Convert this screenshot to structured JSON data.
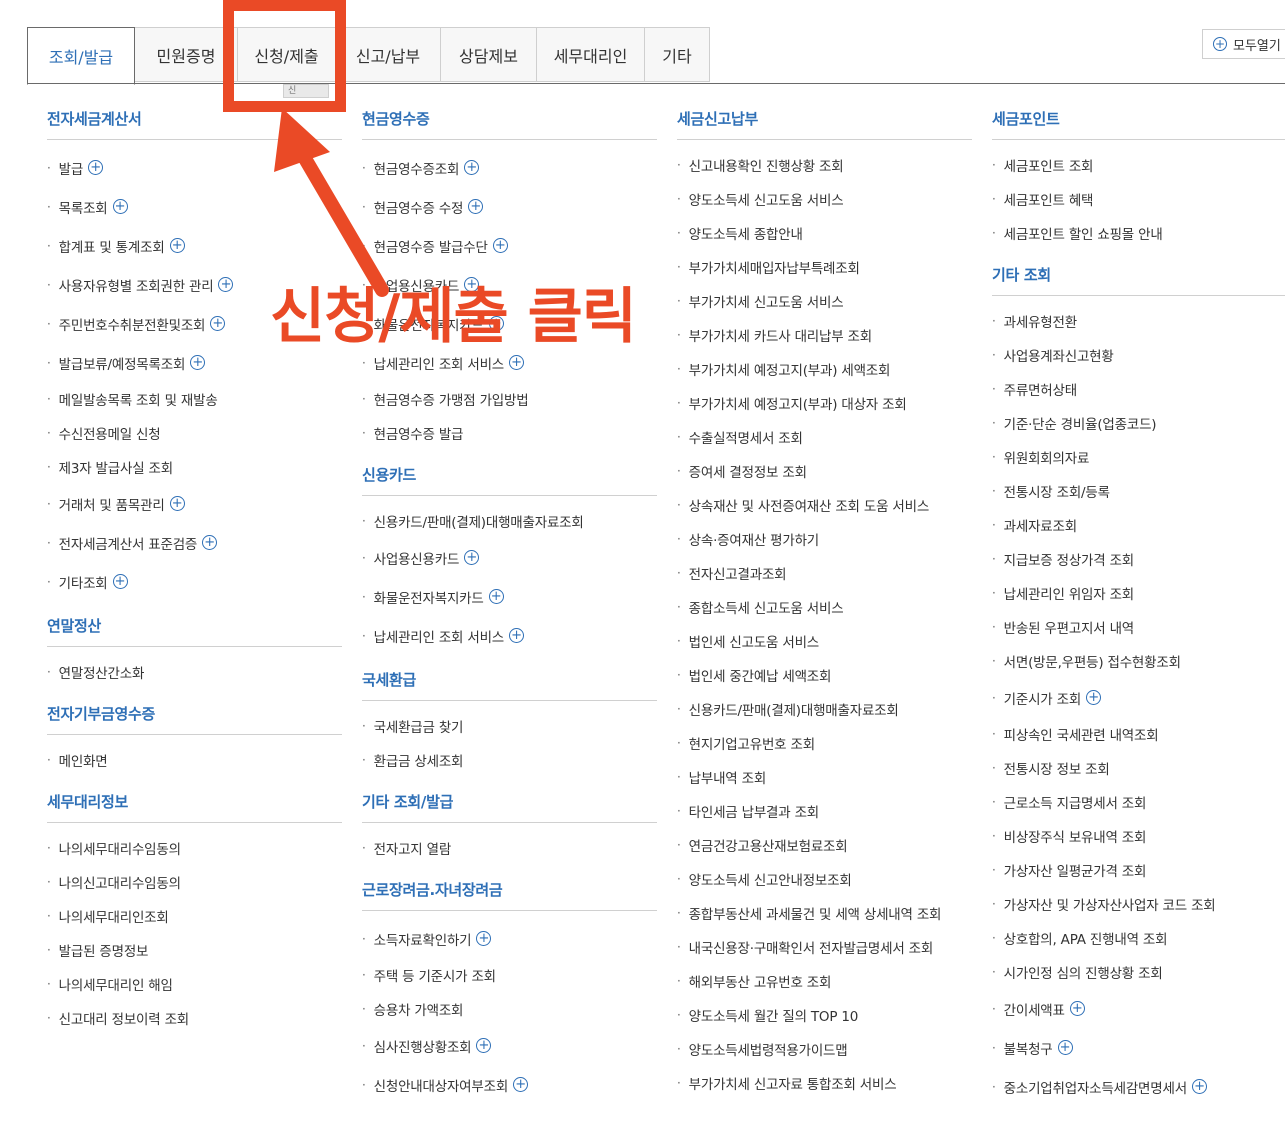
{
  "tabs": [
    {
      "label": "조회/발급",
      "active": true
    },
    {
      "label": "민원증명"
    },
    {
      "label": "신청/제출"
    },
    {
      "label": "신고/납부"
    },
    {
      "label": "상담제보"
    },
    {
      "label": "세무대리인"
    },
    {
      "label": "기타"
    }
  ],
  "expand_all": "모두열기",
  "tooltip_fragment": "신",
  "annotation": {
    "text": "신청/제출 클릭",
    "color": "#ea4a26"
  },
  "accent_color": "#2e6fb6",
  "columns": [
    {
      "sections": [
        {
          "title": "전자세금계산서",
          "items": [
            {
              "label": "발급",
              "plus": true
            },
            {
              "label": "목록조회",
              "plus": true
            },
            {
              "label": "합계표 및 통계조회",
              "plus": true
            },
            {
              "label": "사용자유형별 조회권한 관리",
              "plus": true
            },
            {
              "label": "주민번호수취분전환및조회",
              "plus": true
            },
            {
              "label": "발급보류/예정목록조회",
              "plus": true
            },
            {
              "label": "메일발송목록 조회 및 재발송"
            },
            {
              "label": "수신전용메일 신청"
            },
            {
              "label": "제3자 발급사실 조회"
            },
            {
              "label": "거래처 및 품목관리",
              "plus": true
            },
            {
              "label": "전자세금계산서 표준검증",
              "plus": true
            },
            {
              "label": "기타조회",
              "plus": true
            }
          ]
        },
        {
          "title": "연말정산",
          "items": [
            {
              "label": "연말정산간소화"
            }
          ]
        },
        {
          "title": "전자기부금영수증",
          "items": [
            {
              "label": "메인화면"
            }
          ]
        },
        {
          "title": "세무대리정보",
          "items": [
            {
              "label": "나의세무대리수임동의"
            },
            {
              "label": "나의신고대리수임동의"
            },
            {
              "label": "나의세무대리인조회"
            },
            {
              "label": "발급된 증명정보"
            },
            {
              "label": "나의세무대리인 해임"
            },
            {
              "label": "신고대리 정보이력 조회"
            }
          ]
        }
      ]
    },
    {
      "sections": [
        {
          "title": "현금영수증",
          "items": [
            {
              "label": "현금영수증조회",
              "plus": true
            },
            {
              "label": "현금영수증 수정",
              "plus": true
            },
            {
              "label": "현금영수증 발급수단",
              "plus": true
            },
            {
              "label": "사업용신용카드",
              "plus": true
            },
            {
              "label": "화물운전자복지카드",
              "plus": true
            },
            {
              "label": "납세관리인 조회 서비스",
              "plus": true
            },
            {
              "label": "현금영수증 가맹점 가입방법"
            },
            {
              "label": "현금영수증 발급"
            }
          ]
        },
        {
          "title": "신용카드",
          "items": [
            {
              "label": "신용카드/판매(결제)대행매출자료조회"
            },
            {
              "label": "사업용신용카드",
              "plus": true
            },
            {
              "label": "화물운전자복지카드",
              "plus": true
            },
            {
              "label": "납세관리인 조회 서비스",
              "plus": true
            }
          ]
        },
        {
          "title": "국세환급",
          "items": [
            {
              "label": "국세환급금 찾기"
            },
            {
              "label": "환급금 상세조회"
            }
          ]
        },
        {
          "title": "기타 조회/발급",
          "items": [
            {
              "label": "전자고지 열람"
            }
          ]
        },
        {
          "title": "근로장려금.자녀장려금",
          "items": [
            {
              "label": "소득자료확인하기",
              "plus": true
            },
            {
              "label": "주택 등 기준시가 조회"
            },
            {
              "label": "승용차 가액조회"
            },
            {
              "label": "심사진행상황조회",
              "plus": true
            },
            {
              "label": "신청안내대상자여부조회",
              "plus": true
            }
          ]
        }
      ]
    },
    {
      "sections": [
        {
          "title": "세금신고납부",
          "items": [
            {
              "label": "신고내용확인 진행상황 조회"
            },
            {
              "label": "양도소득세 신고도움 서비스"
            },
            {
              "label": "양도소득세 종합안내"
            },
            {
              "label": "부가가치세매입자납부특례조회"
            },
            {
              "label": "부가가치세 신고도움 서비스"
            },
            {
              "label": "부가가치세 카드사 대리납부 조회"
            },
            {
              "label": "부가가치세 예정고지(부과) 세액조회"
            },
            {
              "label": "부가가치세 예정고지(부과) 대상자 조회"
            },
            {
              "label": "수출실적명세서 조회"
            },
            {
              "label": "증여세 결정정보 조회"
            },
            {
              "label": "상속재산 및 사전증여재산 조회 도움 서비스"
            },
            {
              "label": "상속·증여재산 평가하기"
            },
            {
              "label": "전자신고결과조회"
            },
            {
              "label": "종합소득세 신고도움 서비스"
            },
            {
              "label": "법인세 신고도움 서비스"
            },
            {
              "label": "법인세 중간예납 세액조회"
            },
            {
              "label": "신용카드/판매(결제)대행매출자료조회"
            },
            {
              "label": "현지기업고유번호 조회"
            },
            {
              "label": "납부내역 조회"
            },
            {
              "label": "타인세금 납부결과 조회"
            },
            {
              "label": "연금건강고용산재보험료조회"
            },
            {
              "label": "양도소득세 신고안내정보조회"
            },
            {
              "label": "종합부동산세 과세물건 및 세액 상세내역 조회"
            },
            {
              "label": "내국신용장·구매확인서 전자발급명세서 조회"
            },
            {
              "label": "해외부동산 고유번호 조회"
            },
            {
              "label": "양도소득세 월간 질의 TOP 10"
            },
            {
              "label": "양도소득세법령적용가이드맵"
            },
            {
              "label": "부가가치세 신고자료 통합조회 서비스"
            }
          ]
        }
      ]
    },
    {
      "sections": [
        {
          "title": "세금포인트",
          "items": [
            {
              "label": "세금포인트 조회"
            },
            {
              "label": "세금포인트 혜택"
            },
            {
              "label": "세금포인트 할인 쇼핑몰 안내"
            }
          ]
        },
        {
          "title": "기타 조회",
          "items": [
            {
              "label": "과세유형전환"
            },
            {
              "label": "사업용계좌신고현황"
            },
            {
              "label": "주류면허상태"
            },
            {
              "label": "기준·단순 경비율(업종코드)"
            },
            {
              "label": "위원회회의자료"
            },
            {
              "label": "전통시장 조회/등록"
            },
            {
              "label": "과세자료조회"
            },
            {
              "label": "지급보증 정상가격 조회"
            },
            {
              "label": "납세관리인 위임자 조회"
            },
            {
              "label": "반송된 우편고지서 내역"
            },
            {
              "label": "서면(방문,우편등) 접수현황조회"
            },
            {
              "label": "기준시가 조회",
              "plus": true
            },
            {
              "label": "피상속인 국세관련 내역조회"
            },
            {
              "label": "전통시장 정보 조회"
            },
            {
              "label": "근로소득 지급명세서 조회"
            },
            {
              "label": "비상장주식 보유내역 조회"
            },
            {
              "label": "가상자산 일평균가격 조회"
            },
            {
              "label": "가상자산 및 가상자산사업자 코드 조회"
            },
            {
              "label": "상호합의, APA 진행내역 조회"
            },
            {
              "label": "시가인정 심의 진행상황 조회"
            },
            {
              "label": "간이세액표",
              "plus": true
            },
            {
              "label": "불복청구",
              "plus": true
            },
            {
              "label": "중소기업취업자소득세감면명세서",
              "plus": true
            }
          ]
        }
      ]
    }
  ]
}
